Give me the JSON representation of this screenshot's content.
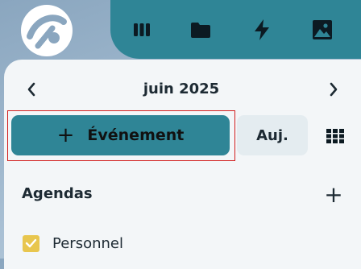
{
  "topbar": {
    "icons": [
      "apps-grid-icon",
      "folder-icon",
      "bolt-icon",
      "image-icon"
    ]
  },
  "calendar": {
    "month_title": "juin 2025",
    "prev_icon": "chevron-left-icon",
    "next_icon": "chevron-right-icon"
  },
  "actions": {
    "new_event_label": "Événement",
    "new_event_icon": "plus-icon",
    "today_label": "Auj.",
    "view_icon": "grid-view-icon"
  },
  "agendas": {
    "title": "Agendas",
    "add_icon": "plus-icon",
    "items": [
      {
        "label": "Personnel",
        "checked": true,
        "color": "#e8c64e"
      }
    ]
  },
  "colors": {
    "accent": "#2f8596",
    "panel": "#f3f6f8",
    "highlight": "#d21e1e"
  }
}
